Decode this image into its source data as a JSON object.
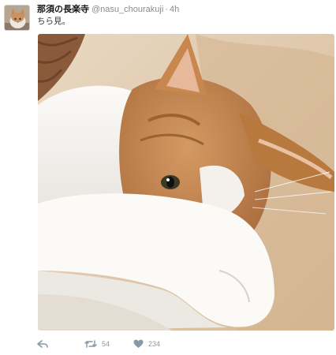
{
  "tweet": {
    "author_name": "那須の長楽寺",
    "handle": "@nasu_chourakuji",
    "separator": "·",
    "time": "4h",
    "text": "ちら見。",
    "avatar_icon": "cat-avatar-icon",
    "photo": "cat-photo"
  },
  "actions": {
    "reply_icon": "reply-icon",
    "retweet_icon": "retweet-icon",
    "retweet_count": "54",
    "like_icon": "heart-icon",
    "like_count": "234"
  },
  "colors": {
    "name": "#14171a",
    "meta": "#8a8a8a",
    "action": "#8899a6",
    "white_fur": "#f2f0ec",
    "orange_fur": "#c8874f",
    "blanket": "#dcc3a6"
  }
}
